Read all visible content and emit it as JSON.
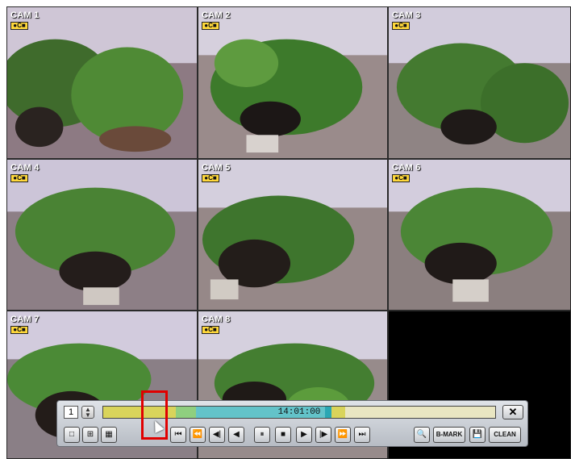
{
  "cameras": [
    {
      "label": "CAM 1",
      "badge": "●C■"
    },
    {
      "label": "CAM 2",
      "badge": "●C■"
    },
    {
      "label": "CAM 3",
      "badge": "●C■"
    },
    {
      "label": "CAM 4",
      "badge": "●C■"
    },
    {
      "label": "CAM 5",
      "badge": "●C■"
    },
    {
      "label": "CAM 6",
      "badge": "●C■"
    },
    {
      "label": "CAM 7",
      "badge": "●C■"
    },
    {
      "label": "CAM 8",
      "badge": "●C■"
    }
  ],
  "playback": {
    "channel": "1",
    "timestamp": "14:01:00",
    "close_icon": "close-icon",
    "bookmark_label": "B-MARK",
    "clean_label": "CLEAN",
    "layout_icons": [
      "single-view-icon",
      "quad-view-icon",
      "nine-view-icon"
    ],
    "transport_icons": [
      "skip-to-start-icon",
      "fast-rewind-icon",
      "step-back-icon",
      "play-reverse-icon",
      "pause-icon",
      "stop-icon",
      "play-icon",
      "step-forward-icon",
      "fast-forward-icon",
      "skip-to-end-icon"
    ],
    "search_icon": "search-icon",
    "save_icon": "save-icon"
  },
  "colors": {
    "timeline_record": "#d9d45b",
    "timeline_motion": "#63c3c9",
    "timeline_green": "#8fcf7f",
    "highlight": "#e10000"
  }
}
